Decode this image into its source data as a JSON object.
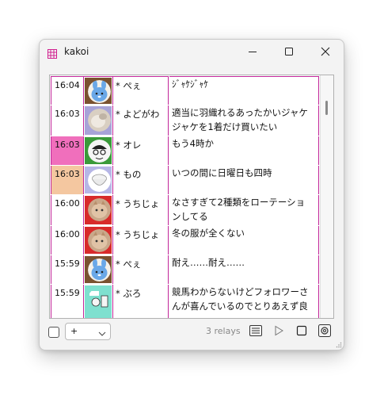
{
  "window": {
    "title": "kakoi"
  },
  "title_bar": {
    "app_icon": "grid-icon",
    "minimize_icon": "minimize-icon",
    "maximize_icon": "maximize-icon",
    "close_icon": "close-icon"
  },
  "colors": {
    "row_border": "#c2269a",
    "highlight_pink": "#f06fbc",
    "highlight_peach": "#f4c7a0"
  },
  "rows": [
    {
      "time": "16:04",
      "name": "* ぺぇ",
      "lines": [
        "ｼﾞｬｹｼﾞｬｹ",
        ""
      ],
      "avatar": "blue-rabbit-avatar",
      "avatar_bg": "#7a5230",
      "highlight": ""
    },
    {
      "time": "16:03",
      "name": "* よどがわ",
      "lines": [
        "適当に羽織れるあったかいジャケ",
        "ジャケを1着だけ買いたい"
      ],
      "avatar": "cat-paw-avatar",
      "avatar_bg": "#a7a3d8",
      "highlight": ""
    },
    {
      "time": "16:03",
      "name": "* オレ",
      "lines": [
        "もう4時か",
        ""
      ],
      "avatar": "sketch-face-avatar",
      "avatar_bg": "#3a9a3a",
      "highlight": "#f06fbc"
    },
    {
      "time": "16:03",
      "name": "* もの",
      "lines": [
        "いつの間に日曜日も四時",
        ""
      ],
      "avatar": "rice-bowl-avatar",
      "avatar_bg": "#b6b6e6",
      "highlight": "#f4c7a0"
    },
    {
      "time": "16:00",
      "name": "* うちじょ",
      "lines": [
        "なさすぎて2種類をローテーショ",
        "ンしてる"
      ],
      "avatar": "kitten-avatar",
      "avatar_bg": "#d82a2a",
      "highlight": ""
    },
    {
      "time": "16:00",
      "name": "* うちじょ",
      "lines": [
        "冬の服が全くない",
        ""
      ],
      "avatar": "kitten-avatar",
      "avatar_bg": "#d82a2a",
      "highlight": ""
    },
    {
      "time": "15:59",
      "name": "* ぺぇ",
      "lines": [
        "耐え……耐え……",
        ""
      ],
      "avatar": "blue-rabbit-avatar",
      "avatar_bg": "#7a5230",
      "highlight": ""
    },
    {
      "time": "15:59",
      "name": "* ぶろ",
      "lines": [
        "競馬わからないけどフォロワーさ",
        "んが喜んでいるのでとりあえず良"
      ],
      "avatar": "cartoon-avatar",
      "avatar_bg": "#7ee0cf",
      "highlight": ""
    }
  ],
  "bottom": {
    "combo_value": "+",
    "relays": "3 relays"
  }
}
